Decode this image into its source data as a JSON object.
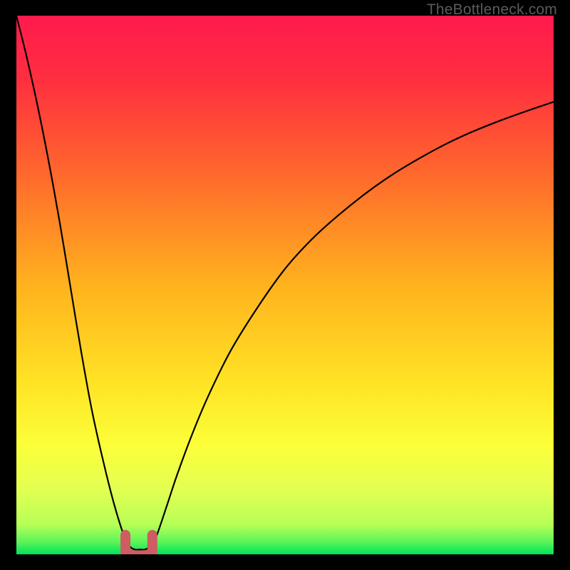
{
  "watermark": "TheBottleneck.com",
  "colors": {
    "black": "#000000",
    "curve": "#000000",
    "marker": "#cf5b63",
    "green": "#00e35a"
  },
  "chart_data": {
    "type": "line",
    "title": "",
    "xlabel": "",
    "ylabel": "",
    "xlim": [
      0,
      100
    ],
    "ylim": [
      0,
      100
    ],
    "series": [
      {
        "name": "bottleneck-curve-left",
        "x": [
          0,
          2,
          4,
          6,
          8,
          10,
          12,
          14,
          16,
          18,
          20,
          21,
          22,
          23
        ],
        "values": [
          100,
          92,
          83,
          73,
          62,
          50,
          38,
          27,
          18,
          10,
          3.5,
          1.6,
          0.9,
          0.9
        ]
      },
      {
        "name": "bottleneck-curve-right",
        "x": [
          23,
          24,
          25,
          26,
          28,
          30,
          33,
          36,
          40,
          45,
          50,
          55,
          60,
          65,
          70,
          75,
          80,
          85,
          90,
          95,
          100
        ],
        "values": [
          0.9,
          0.9,
          1.6,
          3.2,
          9,
          15,
          23,
          30,
          38,
          46,
          53,
          58.5,
          63,
          67,
          70.5,
          73.5,
          76.2,
          78.5,
          80.5,
          82.3,
          84
        ]
      }
    ],
    "marker": {
      "name": "optimal-range",
      "x": [
        20.3,
        25.3
      ],
      "y": 1.2,
      "shape": "U"
    },
    "gradient_stops": [
      {
        "pos": 0.0,
        "color": "#ff1a4e"
      },
      {
        "pos": 0.12,
        "color": "#ff2f3f"
      },
      {
        "pos": 0.3,
        "color": "#ff6a2c"
      },
      {
        "pos": 0.5,
        "color": "#ffb21e"
      },
      {
        "pos": 0.68,
        "color": "#ffe324"
      },
      {
        "pos": 0.8,
        "color": "#fbff3a"
      },
      {
        "pos": 0.88,
        "color": "#e3ff52"
      },
      {
        "pos": 0.945,
        "color": "#b6ff57"
      },
      {
        "pos": 0.975,
        "color": "#62f559"
      },
      {
        "pos": 1.0,
        "color": "#00e35a"
      }
    ]
  }
}
